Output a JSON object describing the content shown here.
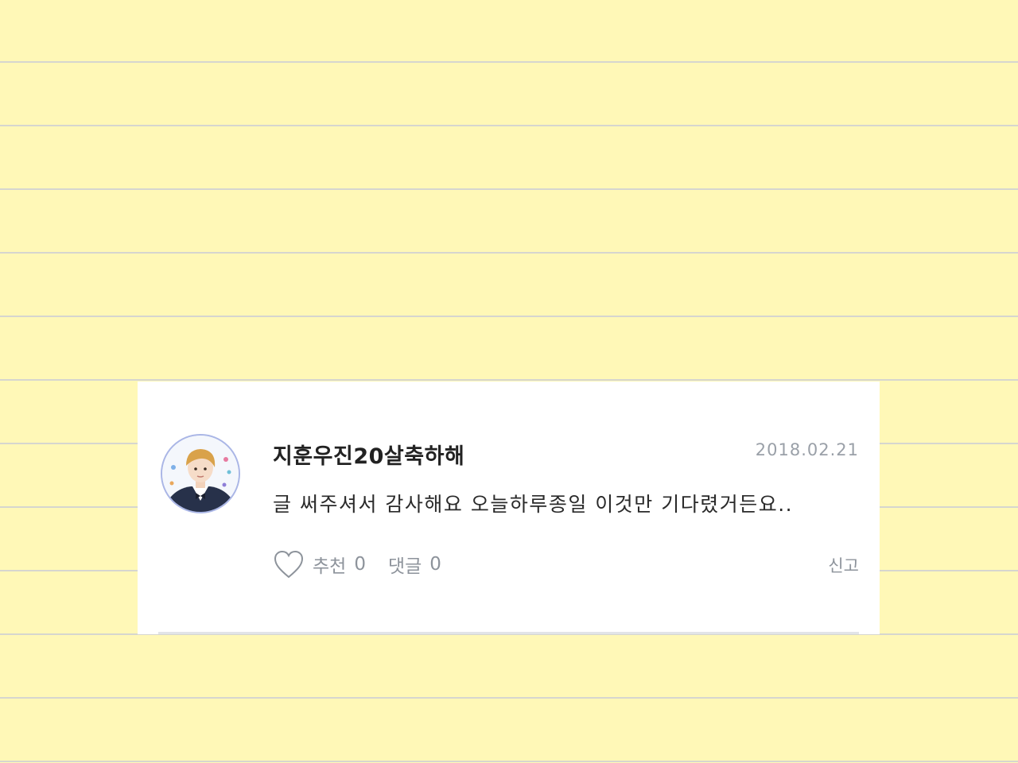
{
  "comment_card": {
    "username": "지훈우진20살축하해",
    "date": "2018.02.21",
    "text": "글 써주셔서 감사해요 오늘하루종일 이것만 기다렸거든요..",
    "like_label": "추천",
    "like_count": "0",
    "reply_label": "댓글",
    "reply_count": "0",
    "report_label": "신고"
  },
  "icons": {
    "like": "heart-outline-icon",
    "avatar": "profile-photo"
  },
  "colors": {
    "paper_background": "#fff8b7",
    "ruled_line": "#d6d6cf",
    "card_background": "#ffffff",
    "avatar_border": "#aab6e6",
    "muted_text": "#8d939b"
  }
}
